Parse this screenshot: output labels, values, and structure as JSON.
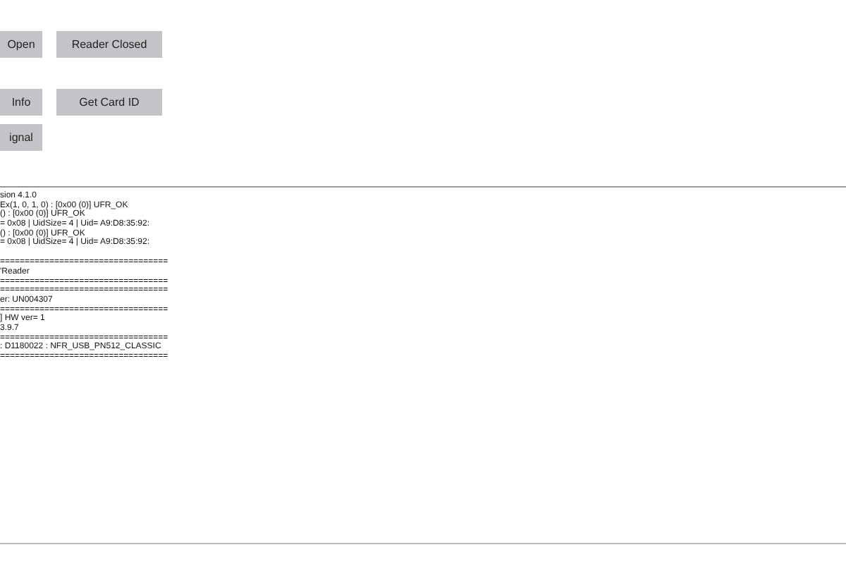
{
  "button_rows": [
    [
      "Open",
      "Reader Closed"
    ],
    [
      "Info",
      "Get Card ID"
    ],
    [
      "ignal"
    ]
  ],
  "log": {
    "blocks": [
      [
        "sion 4.1.0",
        "Ex(1, 0, 1, 0) : [0x00 (0)] UFR_OK",
        "() : [0x00 (0)] UFR_OK",
        "= 0x08 | UidSize= 4 | Uid= A9:D8:35:92:",
        "() : [0x00 (0)] UFR_OK",
        "= 0x08 | UidSize= 4 | Uid= A9:D8:35:92:"
      ],
      [
        "==================================",
        "'Reader",
        "==================================",
        "==================================",
        "er: UN004307",
        "==================================",
        "] HW ver= 1",
        "3.9.7",
        "==================================",
        ": D1180022 : NFR_USB_PN512_CLASSIC",
        "=================================="
      ]
    ]
  }
}
